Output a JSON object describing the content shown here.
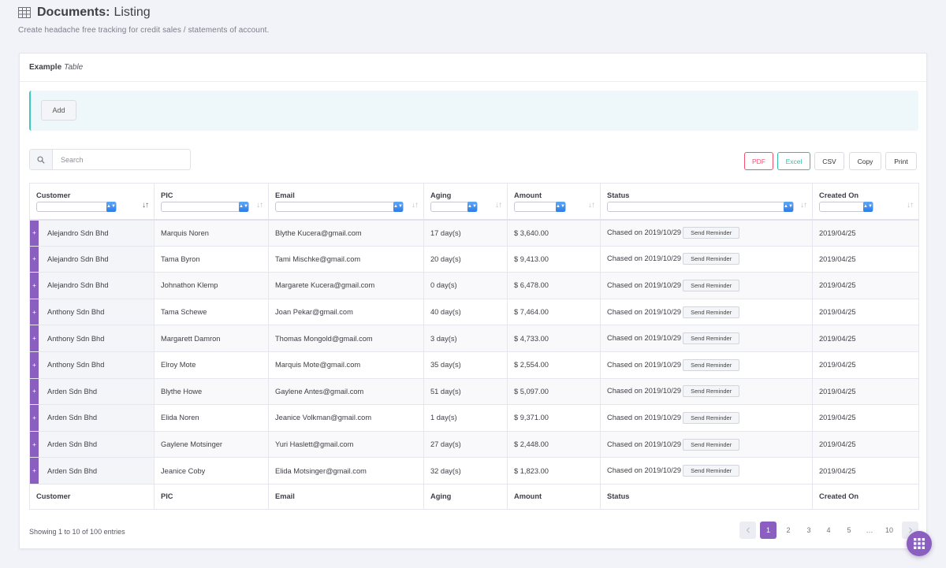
{
  "page": {
    "title_bold": "Documents:",
    "title_light": "Listing",
    "subtitle": "Create headache free tracking for credit sales / statements of account."
  },
  "card": {
    "title_bold": "Example",
    "title_italic": "Table"
  },
  "toolbar": {
    "add_label": "Add"
  },
  "search": {
    "placeholder": "Search",
    "icon": "search-icon"
  },
  "export_buttons": {
    "pdf": "PDF",
    "excel": "Excel",
    "csv": "CSV",
    "copy": "Copy",
    "print": "Print",
    "pdf_color": "#f4516c",
    "excel_color": "#34bfa3"
  },
  "table": {
    "columns": [
      "Customer",
      "PIC",
      "Email",
      "Aging",
      "Amount",
      "Status",
      "Created On"
    ],
    "reminder_label": "Send Reminder",
    "expand_label": "+",
    "rows": [
      {
        "customer": "Alejandro Sdn Bhd",
        "pic": "Marquis Noren",
        "email": "Blythe Kucera@gmail.com",
        "aging": "17 day(s)",
        "amount": "$ 3,640.00",
        "status": "Chased on 2019/10/29",
        "created": "2019/04/25"
      },
      {
        "customer": "Alejandro Sdn Bhd",
        "pic": "Tama Byron",
        "email": "Tami Mischke@gmail.com",
        "aging": "20 day(s)",
        "amount": "$ 9,413.00",
        "status": "Chased on 2019/10/29",
        "created": "2019/04/25"
      },
      {
        "customer": "Alejandro Sdn Bhd",
        "pic": "Johnathon Klemp",
        "email": "Margarete Kucera@gmail.com",
        "aging": "0 day(s)",
        "amount": "$ 6,478.00",
        "status": "Chased on 2019/10/29",
        "created": "2019/04/25"
      },
      {
        "customer": "Anthony Sdn Bhd",
        "pic": "Tama Schewe",
        "email": "Joan Pekar@gmail.com",
        "aging": "40 day(s)",
        "amount": "$ 7,464.00",
        "status": "Chased on 2019/10/29",
        "created": "2019/04/25"
      },
      {
        "customer": "Anthony Sdn Bhd",
        "pic": "Margarett Damron",
        "email": "Thomas Mongold@gmail.com",
        "aging": "3 day(s)",
        "amount": "$ 4,733.00",
        "status": "Chased on 2019/10/29",
        "created": "2019/04/25"
      },
      {
        "customer": "Anthony Sdn Bhd",
        "pic": "Elroy Mote",
        "email": "Marquis Mote@gmail.com",
        "aging": "35 day(s)",
        "amount": "$ 2,554.00",
        "status": "Chased on 2019/10/29",
        "created": "2019/04/25"
      },
      {
        "customer": "Arden Sdn Bhd",
        "pic": "Blythe Howe",
        "email": "Gaylene Antes@gmail.com",
        "aging": "51 day(s)",
        "amount": "$ 5,097.00",
        "status": "Chased on 2019/10/29",
        "created": "2019/04/25"
      },
      {
        "customer": "Arden Sdn Bhd",
        "pic": "Elida Noren",
        "email": "Jeanice Volkman@gmail.com",
        "aging": "1 day(s)",
        "amount": "$ 9,371.00",
        "status": "Chased on 2019/10/29",
        "created": "2019/04/25"
      },
      {
        "customer": "Arden Sdn Bhd",
        "pic": "Gaylene Motsinger",
        "email": "Yuri Haslett@gmail.com",
        "aging": "27 day(s)",
        "amount": "$ 2,448.00",
        "status": "Chased on 2019/10/29",
        "created": "2019/04/25"
      },
      {
        "customer": "Arden Sdn Bhd",
        "pic": "Jeanice Coby",
        "email": "Elida Motsinger@gmail.com",
        "aging": "32 day(s)",
        "amount": "$ 1,823.00",
        "status": "Chased on 2019/10/29",
        "created": "2019/04/25"
      }
    ]
  },
  "footer": {
    "info": "Showing 1 to 10 of 100 entries",
    "pages": [
      "1",
      "2",
      "3",
      "4",
      "5",
      "…",
      "10"
    ],
    "current_page": "1"
  },
  "accent_color": "#8b5fbf"
}
